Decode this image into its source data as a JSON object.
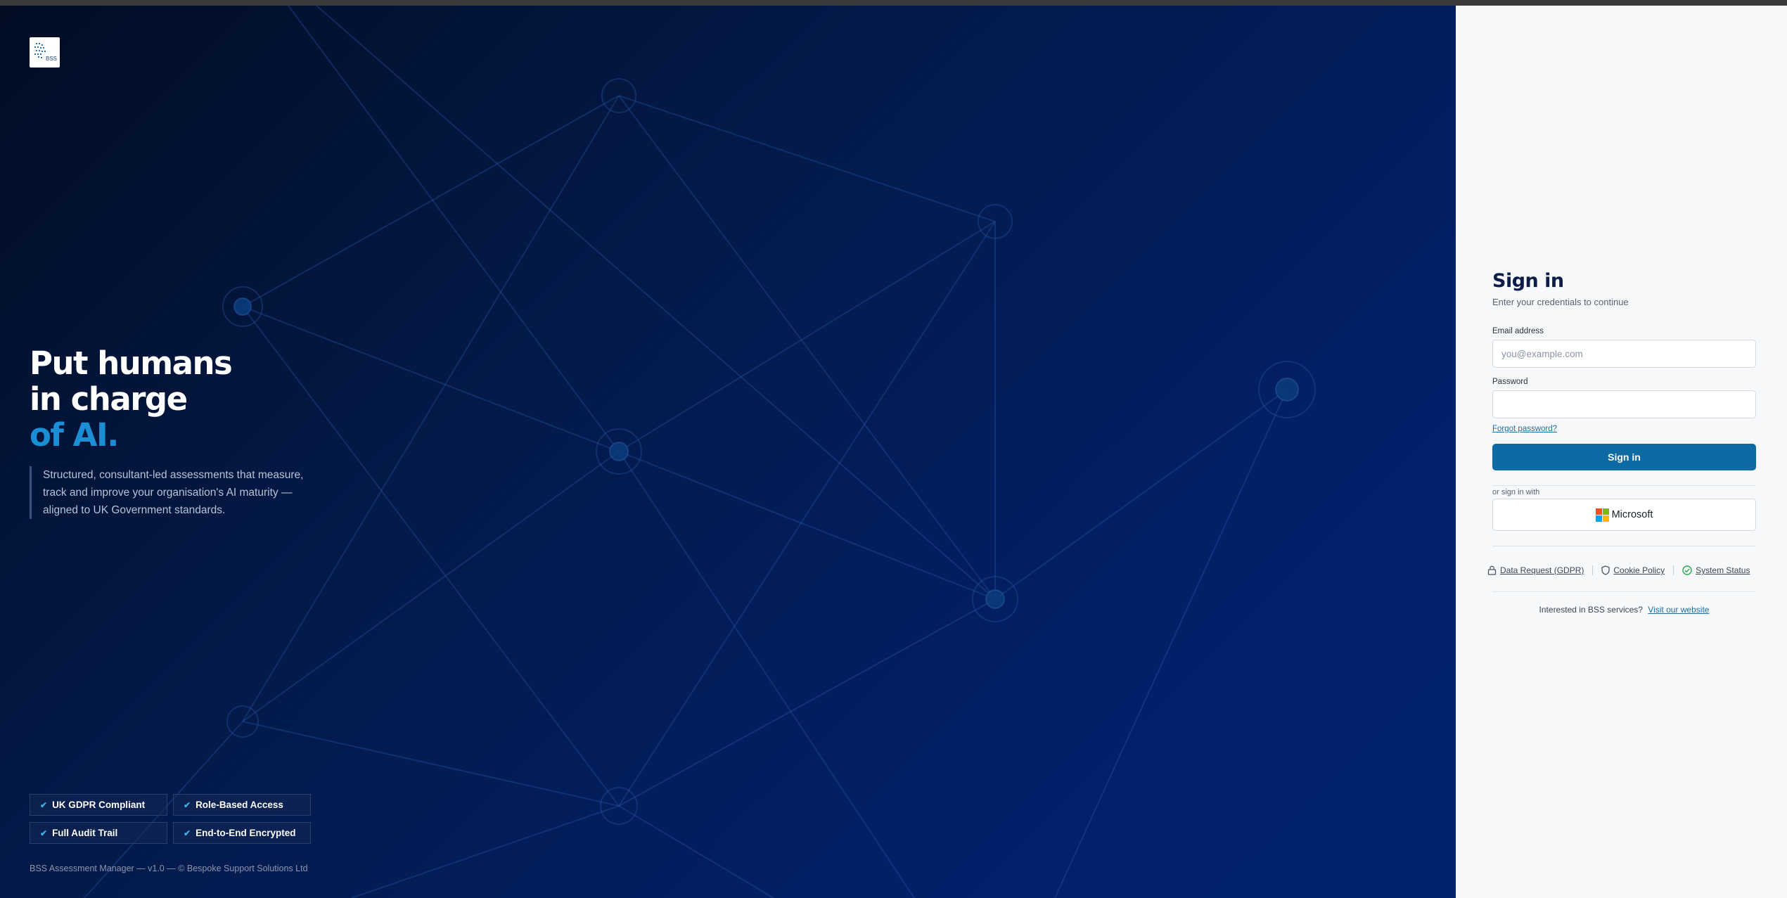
{
  "hero": {
    "headline_line1": "Put humans",
    "headline_line2": "in charge",
    "headline_accent": "of AI.",
    "intro": "Structured, consultant-led assessments that measure, track and improve your organisation's AI maturity — aligned to UK Government standards.",
    "badges": [
      "UK GDPR Compliant",
      "Role-Based Access",
      "Full Audit Trail",
      "End-to-End Encrypted"
    ],
    "footer": "BSS Assessment Manager — v1.0 — © Bespoke Support Solutions Ltd",
    "logo_text": "BSS"
  },
  "signin": {
    "title": "Sign in",
    "subtitle": "Enter your credentials to continue",
    "email_label": "Email address",
    "email_placeholder": "you@example.com",
    "password_label": "Password",
    "forgot": "Forgot password?",
    "button": "Sign in",
    "or_text": "or sign in with",
    "microsoft": "Microsoft",
    "links": {
      "gdpr": "Data Request (GDPR)",
      "cookie": "Cookie Policy",
      "status": "System Status"
    },
    "interest_text": "Interested in BSS services?",
    "website_link": "Visit our website"
  },
  "colors": {
    "accent": "#1a8fd6",
    "primary_button": "#0e6aa3",
    "title": "#0d1d4a",
    "status_ok": "#2fa84f"
  },
  "icons": [
    "check-icon",
    "lock-icon",
    "shield-icon",
    "check-circle-icon",
    "microsoft-logo-icon"
  ]
}
